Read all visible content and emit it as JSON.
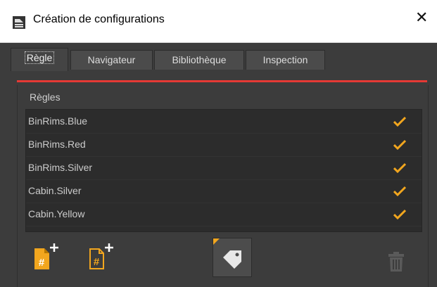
{
  "window": {
    "title": "Création de configurations",
    "close_glyph": "✕"
  },
  "tabs": [
    {
      "label": "Règle",
      "active": true
    },
    {
      "label": "Navigateur",
      "active": false
    },
    {
      "label": "Bibliothèque",
      "active": false
    },
    {
      "label": "Inspection",
      "active": false
    }
  ],
  "rules_panel": {
    "group_label": "Règles",
    "rules": [
      {
        "name": "BinRims.Blue",
        "checked": true
      },
      {
        "name": "BinRims.Red",
        "checked": true
      },
      {
        "name": "BinRims.Silver",
        "checked": true
      },
      {
        "name": "Cabin.Silver",
        "checked": true
      },
      {
        "name": "Cabin.Yellow",
        "checked": true
      }
    ]
  },
  "toolbar": {
    "buttons": [
      {
        "icon": "add-rule-filled-icon",
        "enabled": true
      },
      {
        "icon": "add-rule-outline-icon",
        "enabled": true
      },
      {
        "icon": "tag-icon",
        "enabled": true
      },
      {
        "icon": "trash-icon",
        "enabled": false
      }
    ]
  },
  "colors": {
    "accent_red": "#e53935",
    "accent_orange": "#f2a61e",
    "panel_bg": "#3c3c3c",
    "list_bg": "#2c2c2c"
  }
}
